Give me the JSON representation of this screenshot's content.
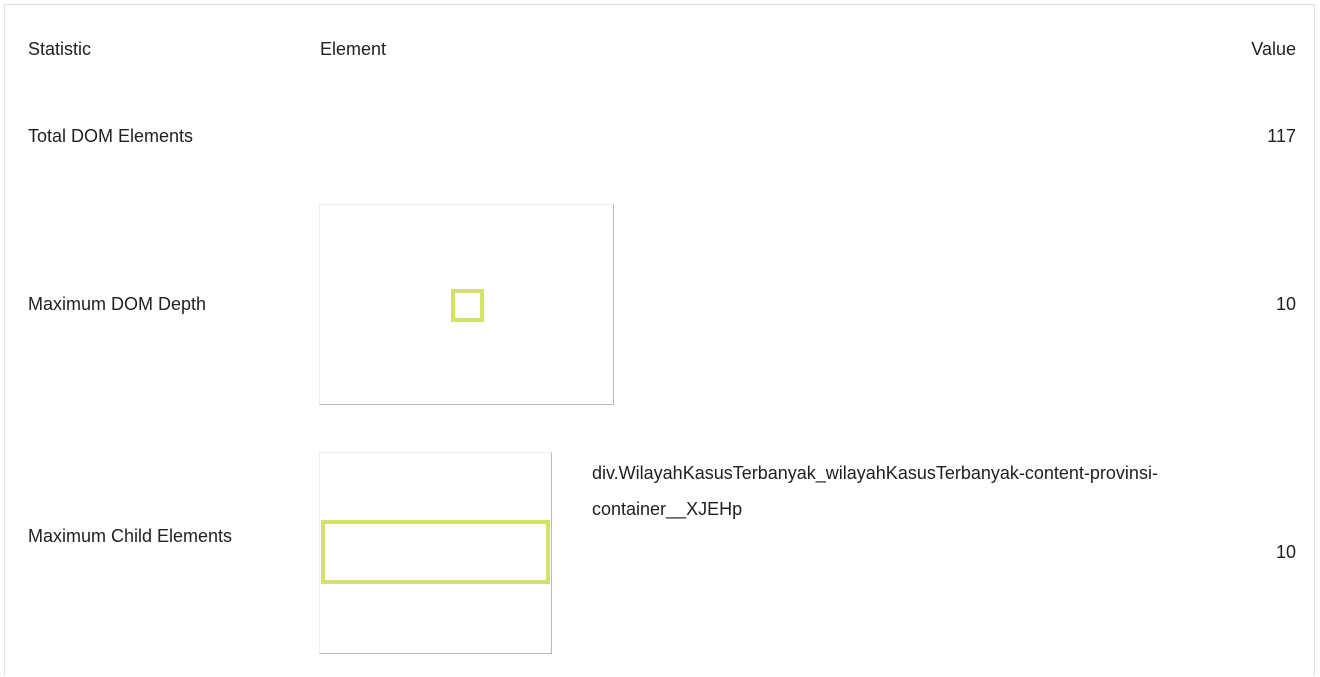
{
  "table": {
    "headers": {
      "statistic": "Statistic",
      "element": "Element",
      "value": "Value"
    },
    "rows": [
      {
        "statistic": "Total DOM Elements",
        "element": "",
        "value": "117"
      },
      {
        "statistic": "Maximum DOM Depth",
        "element": "",
        "value": "10"
      },
      {
        "statistic": "Maximum Child Elements",
        "element": "div.WilayahKasusTerbanyak_wilayahKasusTerbanyak-content-provinsi-container__XJEHp",
        "value": "10"
      }
    ]
  },
  "colors": {
    "highlight": "#d2e26a",
    "border": "#e0e0e0"
  }
}
